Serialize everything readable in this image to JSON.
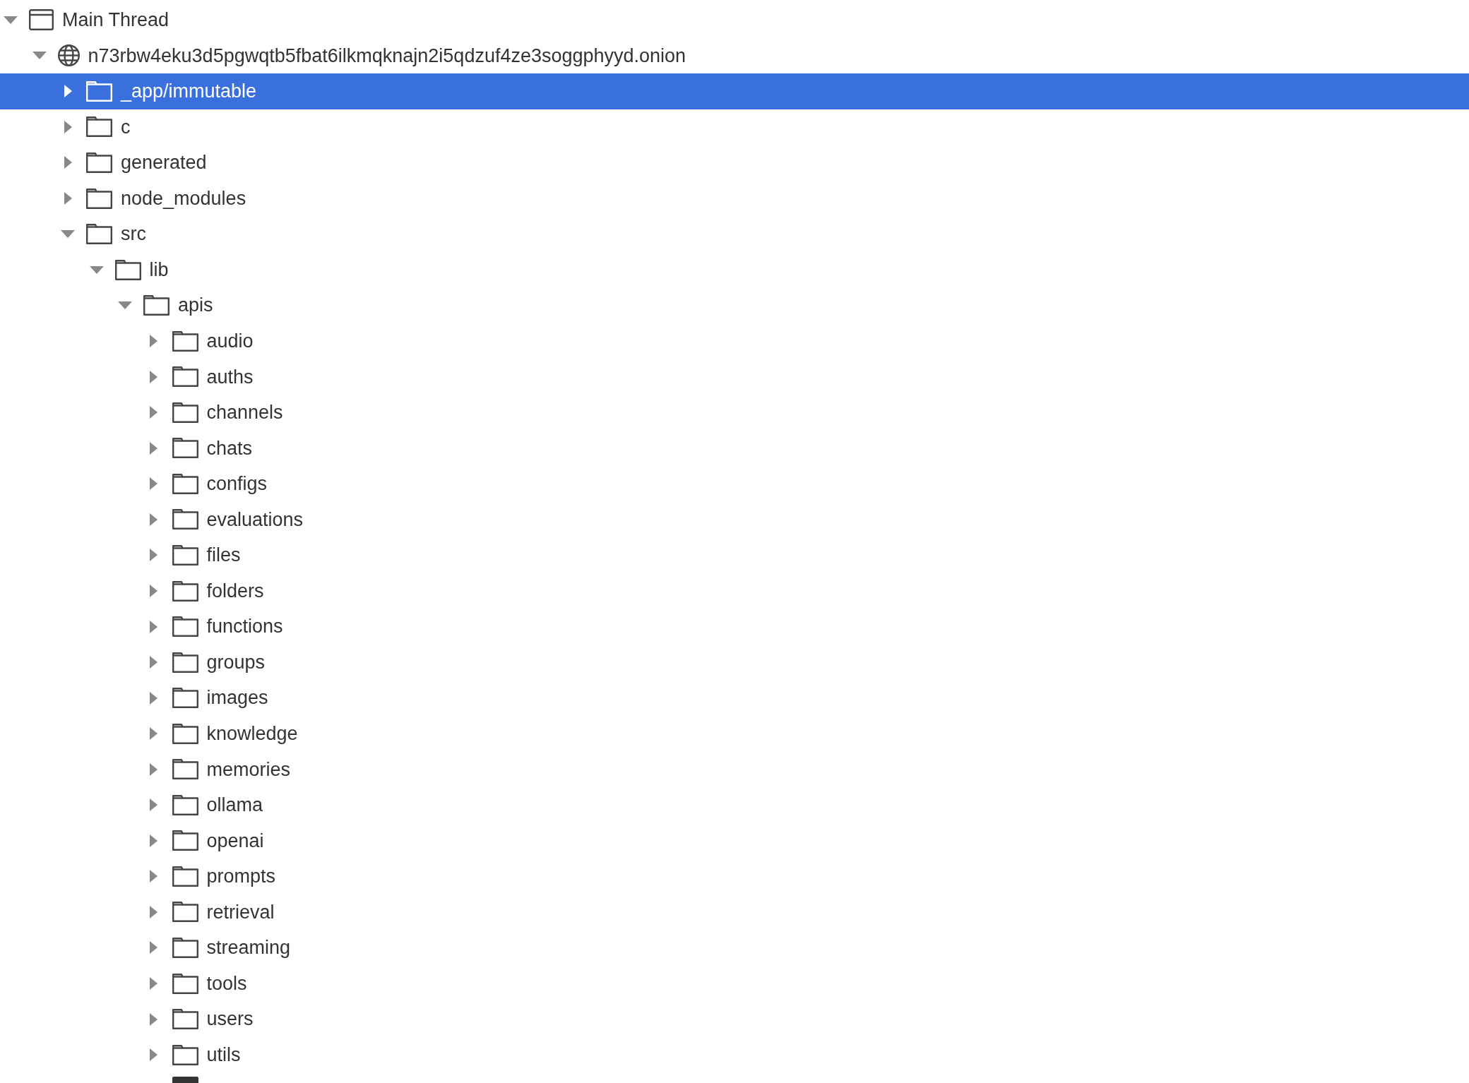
{
  "tree": [
    {
      "label": "Main Thread",
      "kind": "thread",
      "expanded": true,
      "selected": false,
      "children": [
        {
          "label": "n73rbw4eku3d5pgwqtb5fbat6ilkmqknajn2i5qdzuf4ze3soggphyyd.onion",
          "kind": "origin",
          "expanded": true,
          "selected": false,
          "children": [
            {
              "label": "_app/immutable",
              "kind": "folder",
              "expanded": false,
              "selected": true
            },
            {
              "label": "c",
              "kind": "folder",
              "expanded": false,
              "selected": false
            },
            {
              "label": "generated",
              "kind": "folder",
              "expanded": false,
              "selected": false
            },
            {
              "label": "node_modules",
              "kind": "folder",
              "expanded": false,
              "selected": false
            },
            {
              "label": "src",
              "kind": "folder",
              "expanded": true,
              "selected": false,
              "children": [
                {
                  "label": "lib",
                  "kind": "folder",
                  "expanded": true,
                  "selected": false,
                  "children": [
                    {
                      "label": "apis",
                      "kind": "folder",
                      "expanded": true,
                      "selected": false,
                      "children": [
                        {
                          "label": "audio",
                          "kind": "folder",
                          "expanded": false,
                          "selected": false
                        },
                        {
                          "label": "auths",
                          "kind": "folder",
                          "expanded": false,
                          "selected": false
                        },
                        {
                          "label": "channels",
                          "kind": "folder",
                          "expanded": false,
                          "selected": false
                        },
                        {
                          "label": "chats",
                          "kind": "folder",
                          "expanded": false,
                          "selected": false
                        },
                        {
                          "label": "configs",
                          "kind": "folder",
                          "expanded": false,
                          "selected": false
                        },
                        {
                          "label": "evaluations",
                          "kind": "folder",
                          "expanded": false,
                          "selected": false
                        },
                        {
                          "label": "files",
                          "kind": "folder",
                          "expanded": false,
                          "selected": false
                        },
                        {
                          "label": "folders",
                          "kind": "folder",
                          "expanded": false,
                          "selected": false
                        },
                        {
                          "label": "functions",
                          "kind": "folder",
                          "expanded": false,
                          "selected": false
                        },
                        {
                          "label": "groups",
                          "kind": "folder",
                          "expanded": false,
                          "selected": false
                        },
                        {
                          "label": "images",
                          "kind": "folder",
                          "expanded": false,
                          "selected": false
                        },
                        {
                          "label": "knowledge",
                          "kind": "folder",
                          "expanded": false,
                          "selected": false
                        },
                        {
                          "label": "memories",
                          "kind": "folder",
                          "expanded": false,
                          "selected": false
                        },
                        {
                          "label": "ollama",
                          "kind": "folder",
                          "expanded": false,
                          "selected": false
                        },
                        {
                          "label": "openai",
                          "kind": "folder",
                          "expanded": false,
                          "selected": false
                        },
                        {
                          "label": "prompts",
                          "kind": "folder",
                          "expanded": false,
                          "selected": false
                        },
                        {
                          "label": "retrieval",
                          "kind": "folder",
                          "expanded": false,
                          "selected": false
                        },
                        {
                          "label": "streaming",
                          "kind": "folder",
                          "expanded": false,
                          "selected": false
                        },
                        {
                          "label": "tools",
                          "kind": "folder",
                          "expanded": false,
                          "selected": false
                        },
                        {
                          "label": "users",
                          "kind": "folder",
                          "expanded": false,
                          "selected": false
                        },
                        {
                          "label": "utils",
                          "kind": "folder",
                          "expanded": false,
                          "selected": false
                        },
                        {
                          "kind": "partial"
                        }
                      ]
                    }
                  ]
                }
              ]
            }
          ]
        }
      ]
    }
  ]
}
